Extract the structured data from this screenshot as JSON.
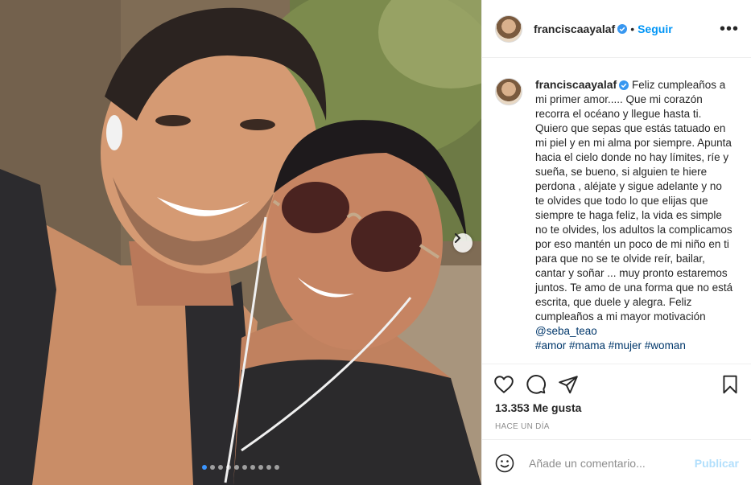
{
  "post": {
    "username": "franciscaayalaf",
    "follow_label": "Seguir",
    "separator": "•",
    "more_label": "•••",
    "caption": "Feliz cumpleaños a mi primer amor..... Que mi corazón recorra el océano y llegue hasta ti. Quiero que sepas que estás tatuado en mi piel y en mi alma por siempre. Apunta hacia el cielo donde no hay límites, ríe y sueña, se bueno, si alguien te hiere perdona , aléjate y sigue adelante y no te olvides que todo lo que elijas que siempre te haga feliz, la vida es simple no te olvides, los adultos la complicamos por eso mantén un poco de mi niño en ti para que no se te olvide reír, bailar, cantar y soñar ... muy pronto estaremos juntos. Te amo de una forma que no está escrita, que duele y alegra. Feliz cumpleaños a mi mayor motivación",
    "mention": "@seba_teao",
    "hashtags": "#amor #mama #mujer #woman",
    "likes": "13.353 Me gusta",
    "time": "HACE UN DÍA",
    "carousel": {
      "count": 10,
      "active": 1
    }
  },
  "icons": {
    "like": "heart-icon",
    "comment": "comment-icon",
    "share": "share-icon",
    "save": "bookmark-icon",
    "emoji": "emoji-icon",
    "next": "chevron-right-icon",
    "verified": "verified-badge-icon"
  },
  "comment_box": {
    "placeholder": "Añade un comentario...",
    "publish_label": "Publicar"
  },
  "colors": {
    "accent": "#0095f6",
    "verified": "#3897f0",
    "publish_disabled": "#b2dffc",
    "link": "#00376b"
  }
}
